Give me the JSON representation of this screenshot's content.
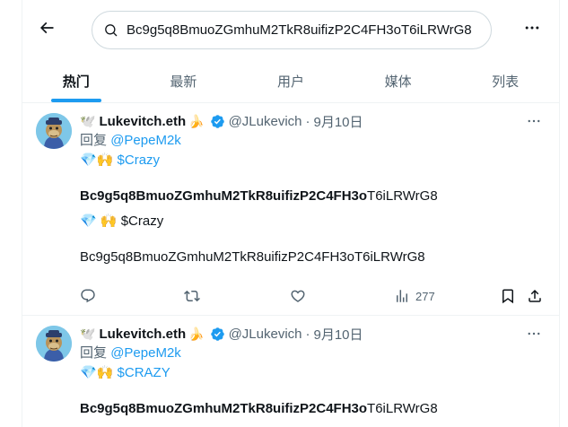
{
  "search": {
    "query": "Bc9g5q8BmuoZGmhuM2TkR8uifizP2C4FH3oT6iLRWrG8"
  },
  "tabs": [
    {
      "label": "热门",
      "active": true
    },
    {
      "label": "最新",
      "active": false
    },
    {
      "label": "用户",
      "active": false
    },
    {
      "label": "媒体",
      "active": false
    },
    {
      "label": "列表",
      "active": false
    }
  ],
  "colors": {
    "accent": "#1d9bf0",
    "secondary_text": "#536471",
    "border": "#eff3f4"
  },
  "tweets": [
    {
      "name_prefix_emoji": "🕊️",
      "name": "Lukevitch.eth",
      "name_suffix_emoji": "🍌",
      "handle": "@JLukevich",
      "date": "9月10日",
      "reply_label": "回复",
      "reply_to": "@PepeM2k",
      "emoji_line": "💎🙌",
      "cashtag_1": "$Crazy",
      "address_bold": "Bc9g5q8BmuoZGmhuM2TkR8uifizP2C4FH3o",
      "address_rest": "T6iLRWrG8",
      "emoji_line_2": "💎 🙌",
      "cashtag_2": "$Crazy",
      "address_plain": "Bc9g5q8BmuoZGmhuM2TkR8uifizP2C4FH3oT6iLRWrG8",
      "views": "277"
    },
    {
      "name_prefix_emoji": "🕊️",
      "name": "Lukevitch.eth",
      "name_suffix_emoji": "🍌",
      "handle": "@JLukevich",
      "date": "9月10日",
      "reply_label": "回复",
      "reply_to": "@PepeM2k",
      "emoji_line": "💎🙌",
      "cashtag_1": "$CRAZY",
      "address_bold": "Bc9g5q8BmuoZGmhuM2TkR8uifizP2C4FH3o",
      "address_rest": "T6iLRWrG8"
    }
  ]
}
